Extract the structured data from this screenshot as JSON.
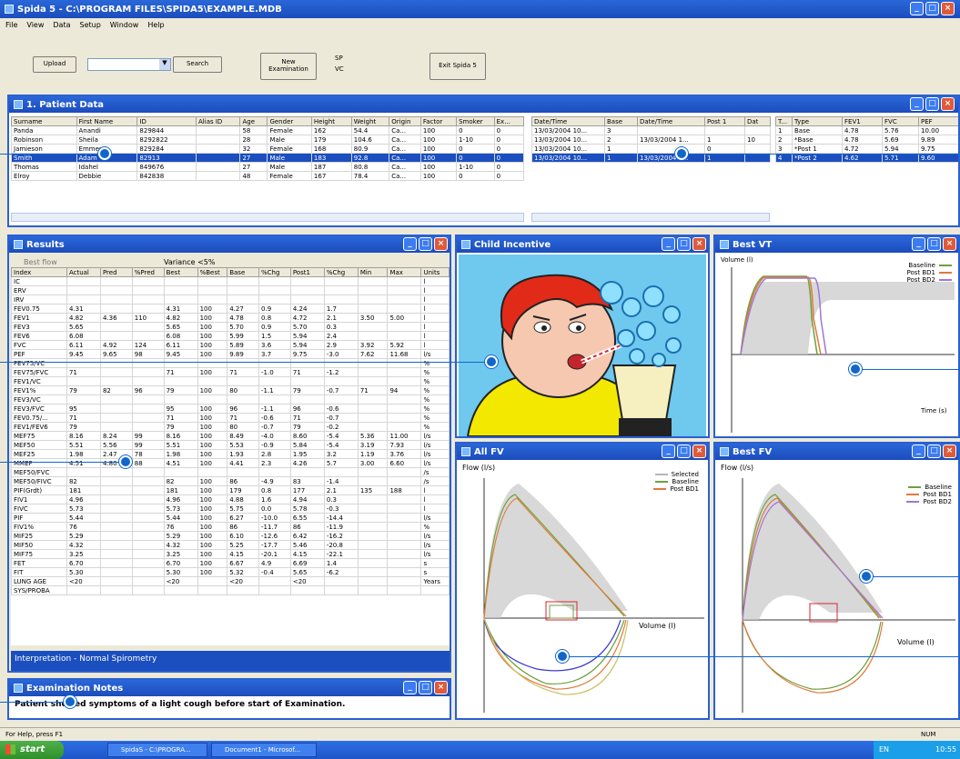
{
  "app": {
    "title": "Spida 5 - C:\\PROGRAM FILES\\SPIDA5\\EXAMPLE.MDB"
  },
  "menu": [
    "File",
    "View",
    "Data",
    "Setup",
    "Window",
    "Help"
  ],
  "toolbar": {
    "upload_label": "Upload",
    "search_label": "Search",
    "new_exam_label": "New Examination",
    "sp_label": "SP",
    "vc_label": "VC",
    "exit_label": "Exit Spida 5"
  },
  "patient_data": {
    "title": "1. Patient Data",
    "columns": [
      "Surname",
      "First Name",
      "ID",
      "Alias ID",
      "Age",
      "Gender",
      "Height",
      "Weight",
      "Origin",
      "Factor",
      "Smoker",
      "Ex..."
    ],
    "rows": [
      [
        "Panda",
        "Anandi",
        "829844",
        "",
        "58",
        "Female",
        "162",
        "54.4",
        "Ca...",
        "100",
        "0",
        "0"
      ],
      [
        "Robinson",
        "Sheila",
        "8292822",
        "",
        "28",
        "Male",
        "179",
        "104.6",
        "Ca...",
        "100",
        "1-10",
        "0"
      ],
      [
        "Jamieson",
        "Emmes",
        "829284",
        "",
        "32",
        "Female",
        "168",
        "80.9",
        "Ca...",
        "100",
        "0",
        "0"
      ],
      [
        "Smith",
        "Adam",
        "82913",
        "",
        "27",
        "Male",
        "183",
        "92.8",
        "Ca...",
        "100",
        "0",
        "0"
      ],
      [
        "Thomas",
        "Idahel",
        "849676",
        "",
        "27",
        "Male",
        "187",
        "80.8",
        "Ca...",
        "100",
        "1-10",
        "0"
      ],
      [
        "Elroy",
        "Debbie",
        "842838",
        "",
        "48",
        "Female",
        "167",
        "78.4",
        "Ca...",
        "100",
        "0",
        "0"
      ]
    ],
    "selected_row": 3,
    "exam_columns": [
      "Date/Time",
      "Base",
      "Date/Time",
      "Post 1",
      "Dat"
    ],
    "exam_rows": [
      [
        "13/03/2004 10...",
        "3",
        "",
        "",
        ""
      ],
      [
        "13/03/2004 10...",
        "2",
        "13/03/2004 1...",
        "1",
        "10"
      ],
      [
        "13/03/2004 10...",
        "1",
        "",
        "0",
        ""
      ],
      [
        "13/03/2004 10...",
        "1",
        "13/03/2004 1...",
        "1",
        ""
      ]
    ],
    "trial_columns": [
      "T...",
      "Type",
      "FEV1",
      "FVC",
      "PEF"
    ],
    "trial_rows": [
      [
        "1",
        "Base",
        "4.78",
        "5.76",
        "10.00"
      ],
      [
        "2",
        "*Base",
        "4.78",
        "5.69",
        "9.89"
      ],
      [
        "3",
        "*Post 1",
        "4.72",
        "5.94",
        "9.75"
      ],
      [
        "4",
        "*Post 2",
        "4.62",
        "5.71",
        "9.60"
      ]
    ]
  },
  "results": {
    "title": "Results",
    "best_flow": "Best flow",
    "variance": "Variance <5%",
    "columns": [
      "Index",
      "Actual",
      "Pred",
      "%Pred",
      "Best",
      "%Best",
      "Base",
      "%Chg",
      "Post1",
      "%Chg",
      "Min",
      "Max",
      "Units"
    ],
    "rows": [
      [
        "IC",
        "",
        "",
        "",
        "",
        "",
        "",
        "",
        "",
        "",
        "",
        "",
        "l"
      ],
      [
        "ERV",
        "",
        "",
        "",
        "",
        "",
        "",
        "",
        "",
        "",
        "",
        "",
        "l"
      ],
      [
        "IRV",
        "",
        "",
        "",
        "",
        "",
        "",
        "",
        "",
        "",
        "",
        "",
        "l"
      ],
      [
        "FEV0.75",
        "4.31",
        "",
        "",
        "4.31",
        "100",
        "4.27",
        "0.9",
        "4.24",
        "1.7",
        "",
        "",
        "l"
      ],
      [
        "FEV1",
        "4.82",
        "4.36",
        "110",
        "4.82",
        "100",
        "4.78",
        "0.8",
        "4.72",
        "2.1",
        "3.50",
        "5.00",
        "l"
      ],
      [
        "FEV3",
        "5.65",
        "",
        "",
        "5.65",
        "100",
        "5.70",
        "0.9",
        "5.70",
        "0.3",
        "",
        "",
        "l"
      ],
      [
        "FEV6",
        "6.08",
        "",
        "",
        "6.08",
        "100",
        "5.99",
        "1.5",
        "5.94",
        "2.4",
        "",
        "",
        "l"
      ],
      [
        "FVC",
        "6.11",
        "4.92",
        "124",
        "6.11",
        "100",
        "5.89",
        "3.6",
        "5.94",
        "2.9",
        "3.92",
        "5.92",
        "l"
      ],
      [
        "PEF",
        "9.45",
        "9.65",
        "98",
        "9.45",
        "100",
        "9.89",
        "3.7",
        "9.75",
        "-3.0",
        "7.62",
        "11.68",
        "l/s"
      ],
      [
        "FEV75/VC",
        "",
        "",
        "",
        "",
        "",
        "",
        "",
        "",
        "",
        "",
        "",
        "%"
      ],
      [
        "FEV75/FVC",
        "71",
        "",
        "",
        "71",
        "100",
        "71",
        "-1.0",
        "71",
        "-1.2",
        "",
        "",
        "%"
      ],
      [
        "FEV1/VC",
        "",
        "",
        "",
        "",
        "",
        "",
        "",
        "",
        "",
        "",
        "",
        "%"
      ],
      [
        "FEV1%",
        "79",
        "82",
        "96",
        "79",
        "100",
        "80",
        "-1.1",
        "79",
        "-0.7",
        "71",
        "94",
        "%"
      ],
      [
        "FEV3/VC",
        "",
        "",
        "",
        "",
        "",
        "",
        "",
        "",
        "",
        "",
        "",
        "%"
      ],
      [
        "FEV3/FVC",
        "95",
        "",
        "",
        "95",
        "100",
        "96",
        "-1.1",
        "96",
        "-0.6",
        "",
        "",
        "%"
      ],
      [
        "FEV0.75/...",
        "71",
        "",
        "",
        "71",
        "100",
        "71",
        "-0.6",
        "71",
        "-0.7",
        "",
        "",
        "%"
      ],
      [
        "FEV1/FEV6",
        "79",
        "",
        "",
        "79",
        "100",
        "80",
        "-0.7",
        "79",
        "-0.2",
        "",
        "",
        "%"
      ],
      [
        "MEF75",
        "8.16",
        "8.24",
        "99",
        "8.16",
        "100",
        "8.49",
        "-4.0",
        "8.60",
        "-5.4",
        "5.36",
        "11.00",
        "l/s"
      ],
      [
        "MEF50",
        "5.51",
        "5.56",
        "99",
        "5.51",
        "100",
        "5.53",
        "-0.9",
        "5.84",
        "-5.4",
        "3.19",
        "7.93",
        "l/s"
      ],
      [
        "MEF25",
        "1.98",
        "2.47",
        "78",
        "1.98",
        "100",
        "1.93",
        "2.8",
        "1.95",
        "3.2",
        "1.19",
        "3.76",
        "l/s"
      ],
      [
        "MMEF",
        "4.51",
        "4.80",
        "88",
        "4.51",
        "100",
        "4.41",
        "2.3",
        "4.26",
        "5.7",
        "3.00",
        "6.60",
        "l/s"
      ],
      [
        "MEF50/FVC",
        "",
        "",
        "",
        "",
        "",
        "",
        "",
        "",
        "",
        "",
        "",
        "/s"
      ],
      [
        "MEF50/FIVC",
        "82",
        "",
        "",
        "82",
        "100",
        "86",
        "-4.9",
        "83",
        "-1.4",
        "",
        "",
        "/s"
      ],
      [
        "PIF(Grdt)",
        "181",
        "",
        "",
        "181",
        "100",
        "179",
        "0.8",
        "177",
        "2.1",
        "135",
        "188",
        "l"
      ],
      [
        "FIV1",
        "4.96",
        "",
        "",
        "4.96",
        "100",
        "4.88",
        "1.6",
        "4.94",
        "0.3",
        "",
        "",
        "l"
      ],
      [
        "FIVC",
        "5.73",
        "",
        "",
        "5.73",
        "100",
        "5.75",
        "0.0",
        "5.78",
        "-0.3",
        "",
        "",
        "l"
      ],
      [
        "PIF",
        "5.44",
        "",
        "",
        "5.44",
        "100",
        "6.27",
        "-10.0",
        "6.55",
        "-14.4",
        "",
        "",
        "l/s"
      ],
      [
        "FIV1%",
        "76",
        "",
        "",
        "76",
        "100",
        "86",
        "-11.7",
        "86",
        "-11.9",
        "",
        "",
        "%"
      ],
      [
        "MIF25",
        "5.29",
        "",
        "",
        "5.29",
        "100",
        "6.10",
        "-12.6",
        "6.42",
        "-16.2",
        "",
        "",
        "l/s"
      ],
      [
        "MIF50",
        "4.32",
        "",
        "",
        "4.32",
        "100",
        "5.25",
        "-17.7",
        "5.46",
        "-20.8",
        "",
        "",
        "l/s"
      ],
      [
        "MIF75",
        "3.25",
        "",
        "",
        "3.25",
        "100",
        "4.15",
        "-20.1",
        "4.15",
        "-22.1",
        "",
        "",
        "l/s"
      ],
      [
        "FET",
        "6.70",
        "",
        "",
        "6.70",
        "100",
        "6.67",
        "4.9",
        "6.69",
        "1.4",
        "",
        "",
        "s"
      ],
      [
        "FIT",
        "5.30",
        "",
        "",
        "5.30",
        "100",
        "5.32",
        "-0.4",
        "5.65",
        "-6.2",
        "",
        "",
        "s"
      ],
      [
        "LUNG AGE",
        "<20",
        "",
        "",
        "<20",
        "",
        "<20",
        "",
        "<20",
        "",
        "",
        "",
        "Years"
      ],
      [
        "SYS/PROBA",
        "",
        "",
        "",
        "",
        "",
        "",
        "",
        "",
        "",
        "",
        "",
        ""
      ]
    ],
    "interpretation": "Interpretation - Normal Spirometry"
  },
  "notes": {
    "title": "Examination Notes",
    "text": "Patient showed symptoms of a light cough before start of Examination."
  },
  "incentive": {
    "title": "Child Incentive"
  },
  "chart_vt": {
    "title": "Best VT",
    "ylabel": "Volume (l)",
    "xlabel": "Time (s)",
    "legend": [
      "Baseline",
      "Post BD1",
      "Post BD2"
    ]
  },
  "chart_fv": {
    "title": "All FV",
    "ylabel": "Flow (l/s)",
    "xlabel": "Volume (l)",
    "legend": [
      "Selected",
      "Baseline",
      "Post BD1"
    ]
  },
  "chart_bfv": {
    "title": "Best FV",
    "ylabel": "Flow (l/s)",
    "xlabel": "Volume (l)",
    "legend": [
      "Baseline",
      "Post BD1",
      "Post BD2"
    ]
  },
  "statusbar": {
    "text": "For Help, press F1",
    "num": "NUM"
  },
  "taskbar": {
    "start": "start",
    "item1": "SpidaS - C:\\PROGRA...",
    "item2": "Document1 - Microsof...",
    "lang": "EN",
    "clock": "10:55"
  },
  "colors": {
    "accent": "#1b4fbf",
    "incentive_bg": "#6fc8ee",
    "baseline": "#6f9f3f",
    "post1": "#e07a3a",
    "post2": "#9b78d8"
  }
}
